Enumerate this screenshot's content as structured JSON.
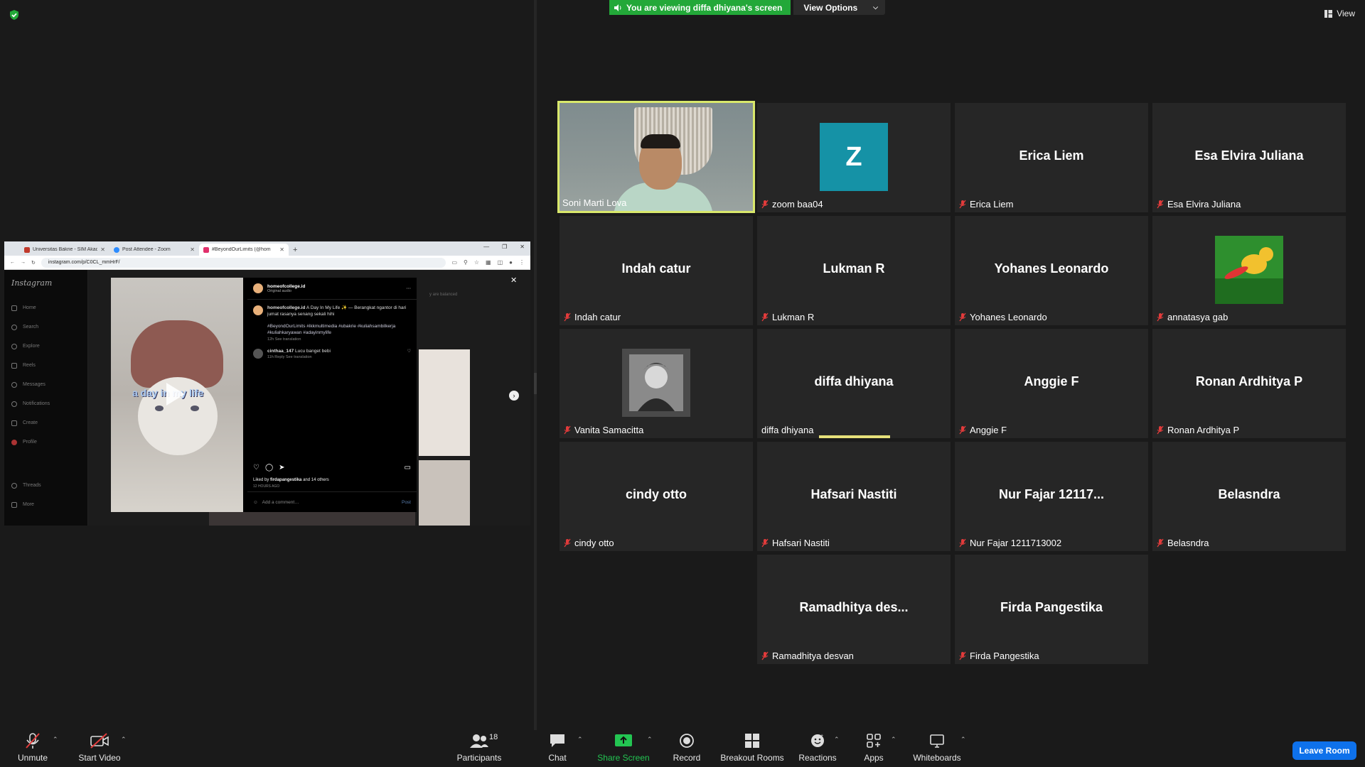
{
  "banner": {
    "viewing_text": "You are viewing diffa dhiyana's screen",
    "view_options": "View Options"
  },
  "view_button": "View",
  "browser": {
    "tabs": [
      {
        "title": "Universitas Bakrie - SIM Akade",
        "color": "#c0392b"
      },
      {
        "title": "Post Attendee - Zoom",
        "color": "#2d8cff"
      },
      {
        "title": "#BeyondOurLimits (@hom",
        "color": "#e1306c"
      }
    ],
    "url": "instagram.com/p/C0CL_mmHrF/"
  },
  "instagram": {
    "logo": "Instagram",
    "nav": [
      "Home",
      "Search",
      "Explore",
      "Reels",
      "Messages",
      "Notifications",
      "Create",
      "Profile"
    ],
    "nav_bottom": [
      "Threads",
      "More"
    ],
    "balanced": "y are balanced",
    "media_text": "a day in my life",
    "username": "homeofcollege.id",
    "audio": "Original audio",
    "caption_user": "homeofcollege.id",
    "caption": "A Day In My Life ✨ — Berangkat ngantor di hari jumat rasanya senang sekali hihi",
    "hashtags": "#BeyondOurLimits #ikkmultimedia #ubakrie #kuliahsambilkerja #kuliahkaryawan #adayinmylife",
    "caption_meta": "12h   See translation",
    "comment_user": "cinthaa_147",
    "comment_text": "Lucu banget bebi",
    "comment_meta": "11h   Reply   See translation",
    "liked_by_prefix": "Liked by",
    "liked_by_user": "firdapangestika",
    "liked_by_suffix": "and 14 others",
    "time_ago": "12 HOURS AGO",
    "add_comment": "Add a comment…",
    "post_button": "Post"
  },
  "participants_tiles": [
    {
      "label": "Soni Marti Lova",
      "type": "video"
    },
    {
      "label": "zoom baa04",
      "type": "initial",
      "initial": "Z"
    },
    {
      "label": "Erica Liem",
      "big": "Erica Liem"
    },
    {
      "label": "Esa Elvira Juliana",
      "big": "Esa Elvira Juliana"
    },
    {
      "label": "Indah catur",
      "big": "Indah catur"
    },
    {
      "label": "Lukman R",
      "big": "Lukman R"
    },
    {
      "label": "Yohanes Leonardo",
      "big": "Yohanes Leonardo"
    },
    {
      "label": "annatasya gab",
      "type": "image"
    },
    {
      "label": "Vanita Samacitta",
      "type": "image"
    },
    {
      "label": "diffa dhiyana",
      "big": "diffa dhiyana"
    },
    {
      "label": "Anggie F",
      "big": "Anggie F"
    },
    {
      "label": "Ronan Ardhitya P",
      "big": "Ronan Ardhitya P"
    },
    {
      "label": "cindy otto",
      "big": "cindy otto"
    },
    {
      "label": "Hafsari Nastiti",
      "big": "Hafsari Nastiti"
    },
    {
      "label": "Nur Fajar 1211713002",
      "big": "Nur Fajar 12117..."
    },
    {
      "label": "Belasndra",
      "big": "Belasndra"
    },
    {
      "label": "Ramadhitya desvan",
      "big": "Ramadhitya des..."
    },
    {
      "label": "Firda Pangestika",
      "big": "Firda Pangestika"
    }
  ],
  "toolbar": {
    "unmute": "Unmute",
    "start_video": "Start Video",
    "participants": "Participants",
    "participants_count": "18",
    "chat": "Chat",
    "share_screen": "Share Screen",
    "record": "Record",
    "breakout_rooms": "Breakout Rooms",
    "reactions": "Reactions",
    "apps": "Apps",
    "whiteboards": "Whiteboards",
    "leave_room": "Leave Room"
  },
  "colors": {
    "share_green": "#23a839",
    "active_speaker": "#d9e86b",
    "zoom_tile": "#1592a6",
    "leave_blue": "#0e71eb"
  }
}
